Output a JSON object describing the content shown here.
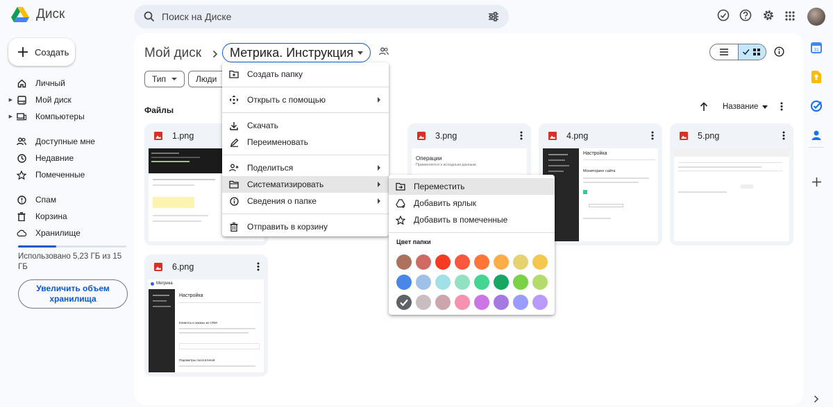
{
  "app": {
    "title": "Диск"
  },
  "search": {
    "placeholder": "Поиск на Диске"
  },
  "sidebar": {
    "new_label": "Создать",
    "items": [
      {
        "label": "Личный",
        "icon": "home-icon"
      },
      {
        "label": "Мой диск",
        "icon": "drive-icon"
      },
      {
        "label": "Компьютеры",
        "icon": "computer-icon"
      },
      {
        "label": "Доступные мне",
        "icon": "people-icon"
      },
      {
        "label": "Недавние",
        "icon": "clock-icon"
      },
      {
        "label": "Помеченные",
        "icon": "star-icon"
      },
      {
        "label": "Спам",
        "icon": "spam-icon"
      },
      {
        "label": "Корзина",
        "icon": "trash-icon"
      },
      {
        "label": "Хранилище",
        "icon": "cloud-icon"
      }
    ],
    "storage": {
      "text": "Использовано 5,23 ГБ из 15 ГБ",
      "used_fraction": 0.35
    },
    "upgrade_label": "Увеличить объем хранилища"
  },
  "breadcrumb": {
    "root": "Мой диск",
    "current": "Метрика. Инструкция"
  },
  "filters": {
    "type_label": "Тип",
    "people_label": "Люди"
  },
  "section": {
    "title": "Файлы",
    "sort_label": "Название"
  },
  "files": [
    {
      "name": "1.png"
    },
    {
      "name": "3.png"
    },
    {
      "name": "4.png"
    },
    {
      "name": "5.png"
    },
    {
      "name": "6.png"
    }
  ],
  "thumb_text": {
    "f3_heading": "Операции",
    "f3_sub": "Применяется к исходным данным.",
    "f4_heading": "Настройка",
    "f4_sub": "Мониторинг сайта",
    "f6_brand": "Метрика",
    "f6_heading": "Настройка",
    "f6_sub1": "Клиенты и заказы из CRM",
    "f6_sub2": "Параметры посетителей"
  },
  "context_menu": {
    "items": [
      {
        "label": "Создать папку",
        "icon": "new-folder-icon"
      },
      {
        "label": "Открыть с помощью",
        "icon": "open-with-icon",
        "submenu": true
      },
      {
        "label": "Скачать",
        "icon": "download-icon"
      },
      {
        "label": "Переименовать",
        "icon": "rename-icon"
      },
      {
        "label": "Поделиться",
        "icon": "share-icon",
        "submenu": true
      },
      {
        "label": "Систематизировать",
        "icon": "organize-icon",
        "submenu": true
      },
      {
        "label": "Сведения о папке",
        "icon": "info-icon",
        "submenu": true
      },
      {
        "label": "Отправить в корзину",
        "icon": "trash-icon"
      }
    ]
  },
  "submenu": {
    "items": [
      {
        "label": "Переместить",
        "icon": "move-icon"
      },
      {
        "label": "Добавить ярлык",
        "icon": "add-shortcut-icon"
      },
      {
        "label": "Добавить в помеченные",
        "icon": "star-icon"
      }
    ],
    "color_title": "Цвет папки",
    "colors": [
      "#ac725e",
      "#d06b64",
      "#f83a22",
      "#fa573c",
      "#ff7537",
      "#ffad46",
      "#e6d270",
      "#f4c74f",
      "#4986e7",
      "#9fc0e7",
      "#9fe1e7",
      "#92e1c0",
      "#42d692",
      "#16a765",
      "#7bd148",
      "#b3dc6c",
      "#5f6368",
      "#cabdbf",
      "#cca6ac",
      "#f691b2",
      "#cd74e6",
      "#a47ae2",
      "#9a9cff",
      "#b99aff"
    ],
    "selected_color_index": 16
  },
  "colors": {
    "accent": "#0b57d0",
    "background": "#f8fafd",
    "image_icon": "#d93025"
  }
}
